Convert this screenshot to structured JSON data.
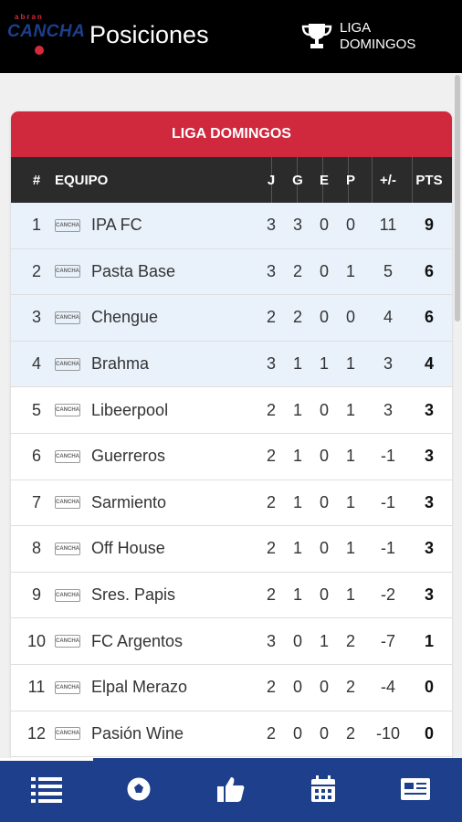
{
  "header": {
    "logo_small": "abran",
    "logo_big": "CANCHA",
    "title": "Posiciones",
    "league_label": "LIGA DOMINGOS"
  },
  "card": {
    "title": "LIGA DOMINGOS",
    "columns": {
      "pos": "#",
      "team": "EQUIPO",
      "j": "J",
      "g": "G",
      "e": "E",
      "p": "P",
      "dif": "+/-",
      "pts": "PTS"
    }
  },
  "rows": [
    {
      "pos": "1",
      "team": "IPA FC",
      "j": "3",
      "g": "3",
      "e": "0",
      "p": "0",
      "dif": "11",
      "pts": "9",
      "highlighted": true
    },
    {
      "pos": "2",
      "team": "Pasta Base",
      "j": "3",
      "g": "2",
      "e": "0",
      "p": "1",
      "dif": "5",
      "pts": "6",
      "highlighted": true
    },
    {
      "pos": "3",
      "team": "Chengue",
      "j": "2",
      "g": "2",
      "e": "0",
      "p": "0",
      "dif": "4",
      "pts": "6",
      "highlighted": true
    },
    {
      "pos": "4",
      "team": "Brahma",
      "j": "3",
      "g": "1",
      "e": "1",
      "p": "1",
      "dif": "3",
      "pts": "4",
      "highlighted": true
    },
    {
      "pos": "5",
      "team": "Libeerpool",
      "j": "2",
      "g": "1",
      "e": "0",
      "p": "1",
      "dif": "3",
      "pts": "3",
      "highlighted": false
    },
    {
      "pos": "6",
      "team": "Guerreros",
      "j": "2",
      "g": "1",
      "e": "0",
      "p": "1",
      "dif": "-1",
      "pts": "3",
      "highlighted": false
    },
    {
      "pos": "7",
      "team": "Sarmiento",
      "j": "2",
      "g": "1",
      "e": "0",
      "p": "1",
      "dif": "-1",
      "pts": "3",
      "highlighted": false
    },
    {
      "pos": "8",
      "team": "Off House",
      "j": "2",
      "g": "1",
      "e": "0",
      "p": "1",
      "dif": "-1",
      "pts": "3",
      "highlighted": false
    },
    {
      "pos": "9",
      "team": "Sres. Papis",
      "j": "2",
      "g": "1",
      "e": "0",
      "p": "1",
      "dif": "-2",
      "pts": "3",
      "highlighted": false
    },
    {
      "pos": "10",
      "team": "FC Argentos",
      "j": "3",
      "g": "0",
      "e": "1",
      "p": "2",
      "dif": "-7",
      "pts": "1",
      "highlighted": false
    },
    {
      "pos": "11",
      "team": "Elpal Merazo",
      "j": "2",
      "g": "0",
      "e": "0",
      "p": "2",
      "dif": "-4",
      "pts": "0",
      "highlighted": false
    },
    {
      "pos": "12",
      "team": "Pasión Wine",
      "j": "2",
      "g": "0",
      "e": "0",
      "p": "2",
      "dif": "-10",
      "pts": "0",
      "highlighted": false
    }
  ],
  "team_badge_text": "CANCHA",
  "bottom_nav": [
    {
      "icon": "standings-list-icon",
      "active": true
    },
    {
      "icon": "soccer-ball-icon",
      "active": false
    },
    {
      "icon": "thumbs-up-icon",
      "active": false
    },
    {
      "icon": "calendar-icon",
      "active": false
    },
    {
      "icon": "news-card-icon",
      "active": false
    }
  ],
  "colors": {
    "top_bar": "#000000",
    "card_header": "#d0283d",
    "table_header": "#2b2b2b",
    "highlight_row": "#e9f2fb",
    "bottom_nav": "#1d3f8c"
  }
}
